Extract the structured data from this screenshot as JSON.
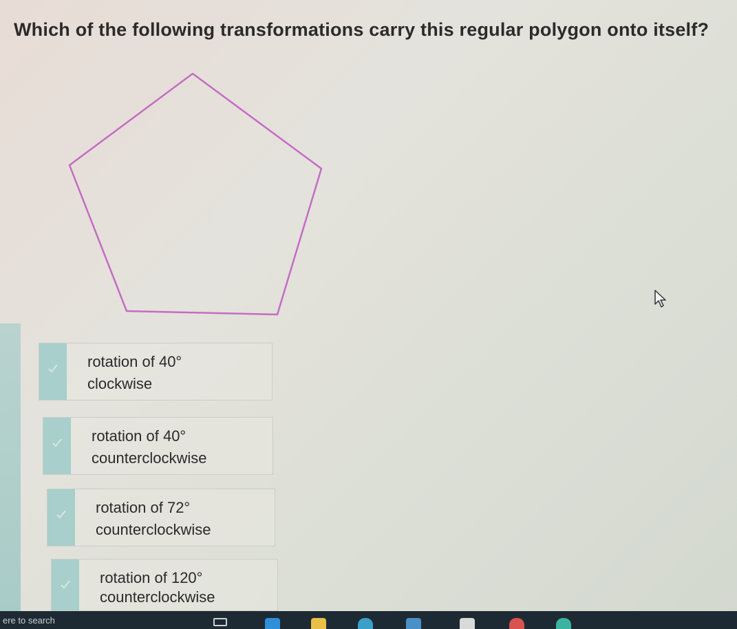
{
  "question": "Which of the following transformations carry this regular polygon onto itself?",
  "choices": [
    {
      "line1": "rotation of 40°",
      "line2": "clockwise"
    },
    {
      "line1": "rotation of 40°",
      "line2": "counterclockwise"
    },
    {
      "line1": "rotation of 72°",
      "line2": "counterclockwise"
    },
    {
      "line1": "rotation of 120°",
      "line2": "counterclockwise"
    }
  ],
  "taskbar": {
    "search_text": "ere to search"
  },
  "colors": {
    "polygon_stroke": "#c46cc4",
    "checkbox": "#a8cfcc",
    "taskbar": "#1e2a33"
  },
  "icons": [
    "check-icon",
    "mouse-pointer-icon",
    "taskview-icon",
    "edge-icon",
    "file-explorer-icon",
    "store-icon",
    "chrome-icon"
  ]
}
